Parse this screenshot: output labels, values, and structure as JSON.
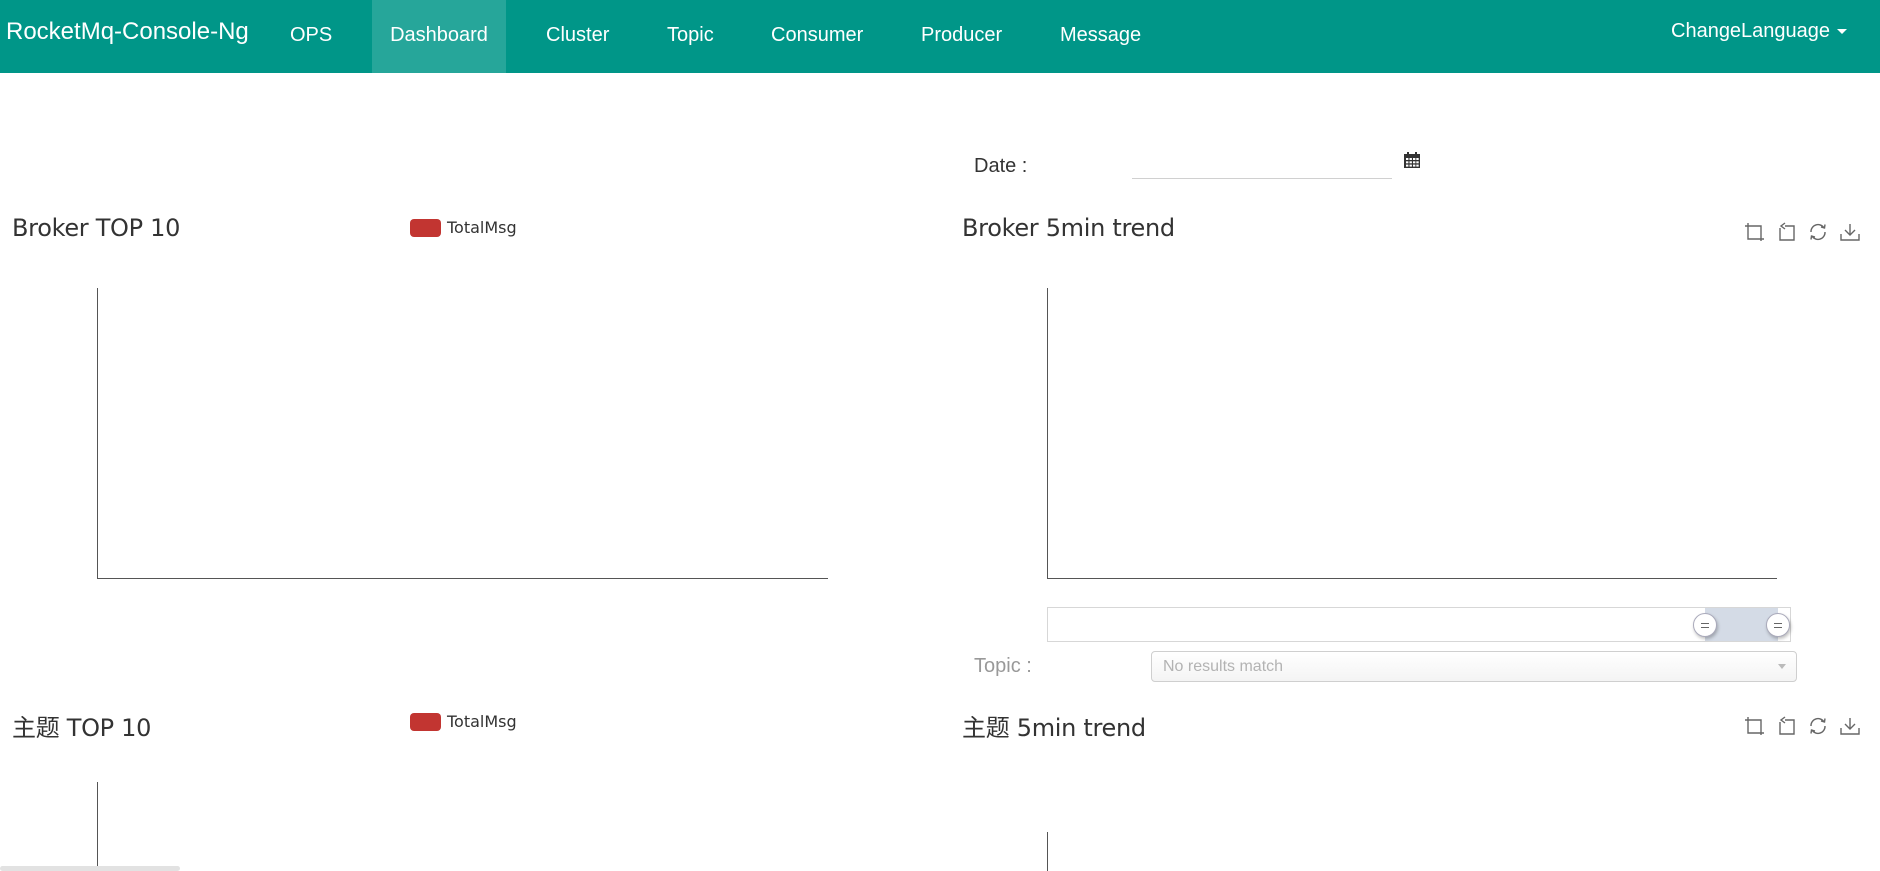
{
  "navbar": {
    "brand": "RocketMq-Console-Ng",
    "items": [
      "OPS",
      "Dashboard",
      "Cluster",
      "Topic",
      "Consumer",
      "Producer",
      "Message"
    ],
    "active": "Dashboard",
    "language_menu": "ChangeLanguage"
  },
  "filters": {
    "date_label": "Date :",
    "date_value": "",
    "topic_label": "Topic :",
    "topic_select_text": "No results match"
  },
  "panels": {
    "broker_top": {
      "title": "Broker TOP 10",
      "legend": "TotalMsg"
    },
    "broker_trend": {
      "title": "Broker 5min trend"
    },
    "topic_top": {
      "title": "主题 TOP 10",
      "legend": "TotalMsg"
    },
    "topic_trend": {
      "title": "主题 5min trend"
    }
  },
  "toolbox_icons": [
    "zoom-icon",
    "zoom-reset-icon",
    "restore-icon",
    "save-image-icon"
  ],
  "colors": {
    "navbar": "#009688",
    "navbar_active": "#26a69a",
    "legend_swatch": "#c23531"
  },
  "chart_data": [
    {
      "type": "bar",
      "title": "Broker TOP 10",
      "series": [
        {
          "name": "TotalMsg",
          "values": []
        }
      ],
      "categories": []
    },
    {
      "type": "line",
      "title": "Broker 5min trend",
      "series": [],
      "x": []
    },
    {
      "type": "bar",
      "title": "主题 TOP 10",
      "series": [
        {
          "name": "TotalMsg",
          "values": []
        }
      ],
      "categories": []
    },
    {
      "type": "line",
      "title": "主题 5min trend",
      "series": [],
      "x": []
    }
  ]
}
